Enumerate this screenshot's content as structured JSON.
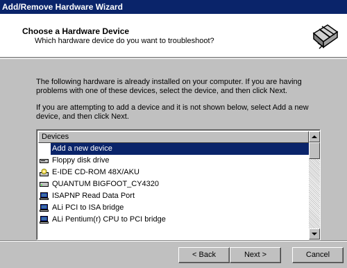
{
  "window": {
    "title": "Add/Remove Hardware Wizard"
  },
  "header": {
    "title": "Choose a Hardware Device",
    "subtitle": "Which hardware device do you want to troubleshoot?"
  },
  "body": {
    "paragraph1": "The following hardware is already installed on your computer. If you are having problems with one of these devices, select the device, and then click Next.",
    "paragraph2": "If you are attempting to add a device and it is not shown below, select Add a new device, and then click Next."
  },
  "devices": {
    "column_header": "Devices",
    "items": [
      {
        "label": "Add a new device",
        "icon": "none",
        "selected": true
      },
      {
        "label": "Floppy disk drive",
        "icon": "floppy-drive-icon",
        "selected": false
      },
      {
        "label": "E-IDE CD-ROM 48X/AKU",
        "icon": "cdrom-icon",
        "selected": false
      },
      {
        "label": "QUANTUM BIGFOOT_CY4320",
        "icon": "hard-disk-icon",
        "selected": false
      },
      {
        "label": "ISAPNP Read Data Port",
        "icon": "computer-icon",
        "selected": false
      },
      {
        "label": "ALi PCI to ISA bridge",
        "icon": "computer-icon",
        "selected": false
      },
      {
        "label": "ALi Pentium(r) CPU to PCI bridge",
        "icon": "computer-icon",
        "selected": false
      }
    ]
  },
  "buttons": {
    "back": "< Back",
    "next": "Next >",
    "cancel": "Cancel"
  }
}
